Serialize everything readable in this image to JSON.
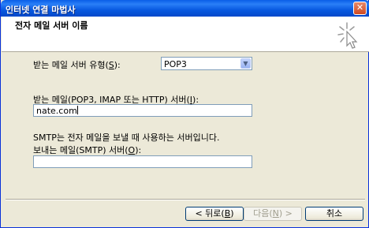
{
  "window": {
    "title": "인터넷 연결 마법사",
    "close_glyph": "✕"
  },
  "header": {
    "title": "전자 메일 서버 이름",
    "icon": "wizard-sparkle-icon"
  },
  "form": {
    "incoming_type": {
      "label_pre": "받는 메일 서버 유형(",
      "label_key": "S",
      "label_post": "):",
      "value": "POP3"
    },
    "incoming_server": {
      "label_pre": "받는 메일(POP3, IMAP 또는 HTTP) 서버(",
      "label_key": "I",
      "label_post": "):",
      "value": "nate.com"
    },
    "smtp_note": "SMTP는 전자 메일을 보낼 때 사용하는 서버입니다.",
    "outgoing_server": {
      "label_pre": "보내는 메일(SMTP) 서버(",
      "label_key": "O",
      "label_post": "):",
      "value": ""
    }
  },
  "buttons": {
    "back": {
      "pre": "< 뒤로(",
      "key": "B",
      "post": ")"
    },
    "next": {
      "pre": "다음(",
      "key": "N",
      "post": ") >"
    },
    "cancel": "취소"
  }
}
